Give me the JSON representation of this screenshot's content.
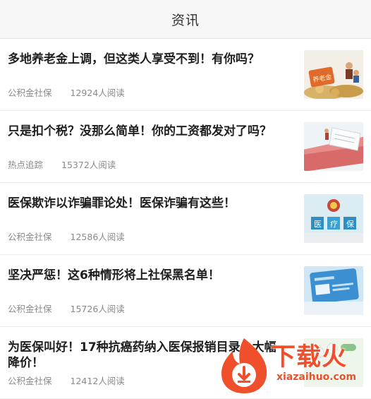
{
  "header": {
    "title": "资讯"
  },
  "articles": [
    {
      "title": "多地养老金上调，但这类人享受不到！有你吗？",
      "source": "公积金社保",
      "reads": "12924人阅读"
    },
    {
      "title": "只是扣个税？没那么简单！你的工资都发对了吗？",
      "source": "热点追踪",
      "reads": "15372人阅读"
    },
    {
      "title": "医保欺诈以诈骗罪论处！医保诈骗有这些！",
      "source": "公积金社保",
      "reads": "12586人阅读"
    },
    {
      "title": "坚决严惩！这6种情形将上社保黑名单！",
      "source": "公积金社保",
      "reads": "15726人阅读"
    },
    {
      "title": "为医保叫好！17种抗癌药纳入医保报销目录，大幅降价！",
      "source": "公积金社保",
      "reads": "12412人阅读"
    }
  ],
  "thumb_labels": {
    "pension": "养老金",
    "medical": [
      "医",
      "疗",
      "保"
    ]
  },
  "watermark": {
    "text": "下载火",
    "url": "xiazaihuo.com",
    "color": "#ef4f2b"
  }
}
